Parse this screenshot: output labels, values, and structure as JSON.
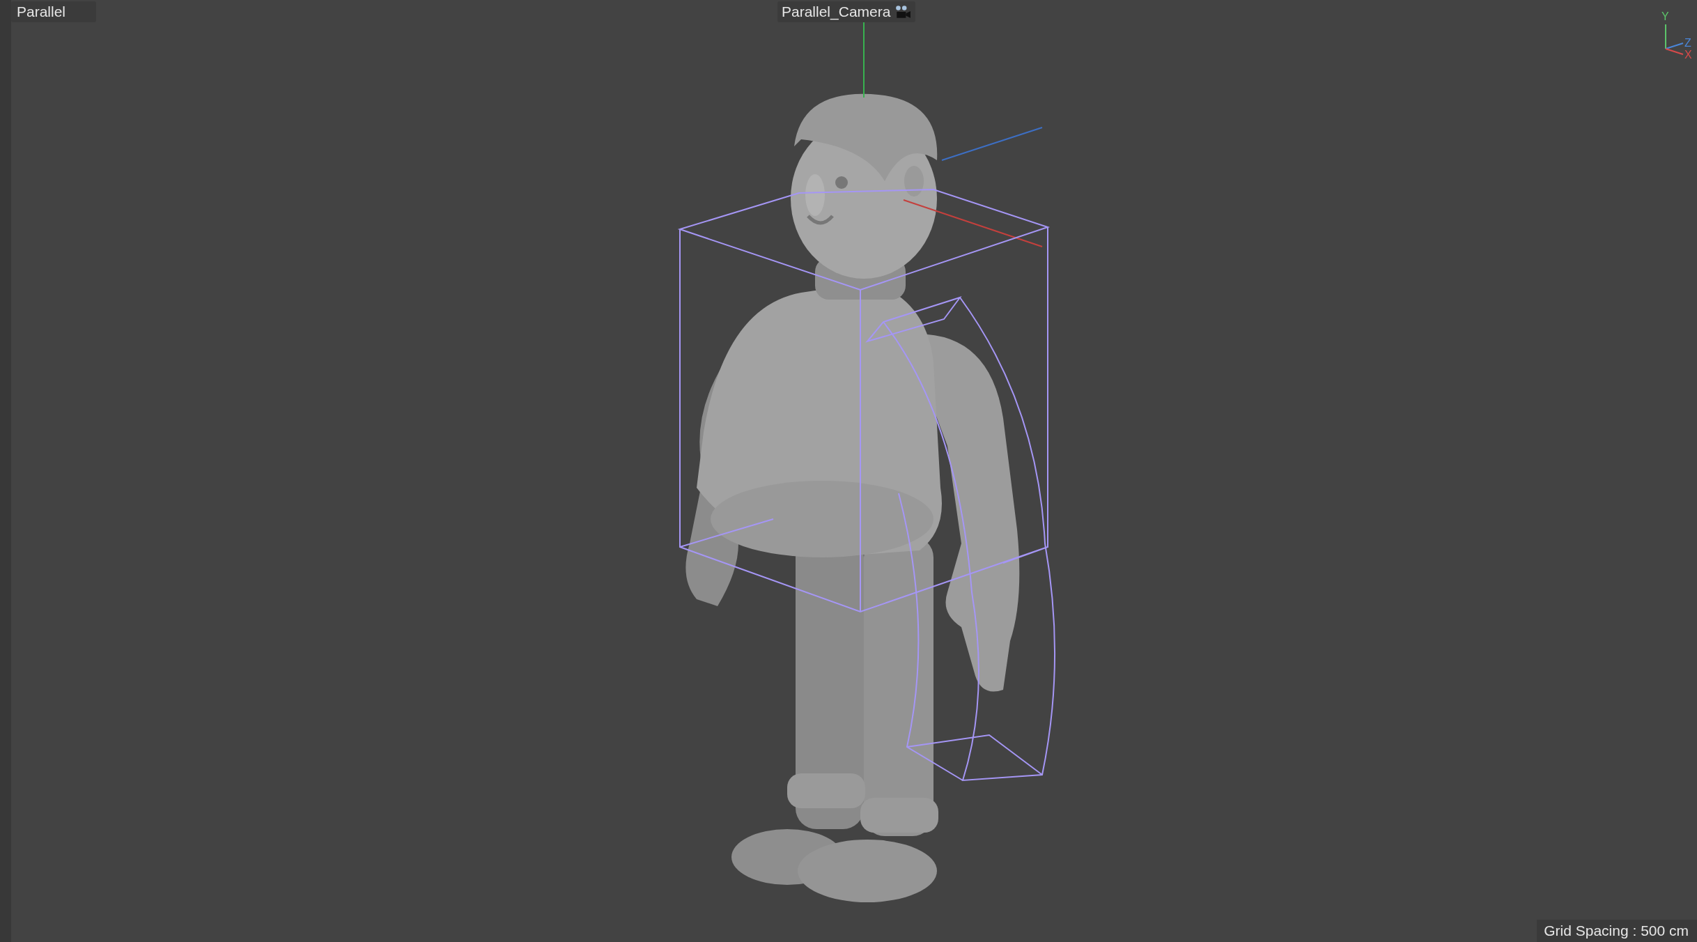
{
  "viewport": {
    "view_label": "Parallel",
    "camera_label": "Parallel_Camera",
    "grid_spacing": "Grid Spacing : 500 cm"
  },
  "axis_gizmo": {
    "y_label": "Y",
    "z_label": "Z",
    "x_label": "X"
  }
}
